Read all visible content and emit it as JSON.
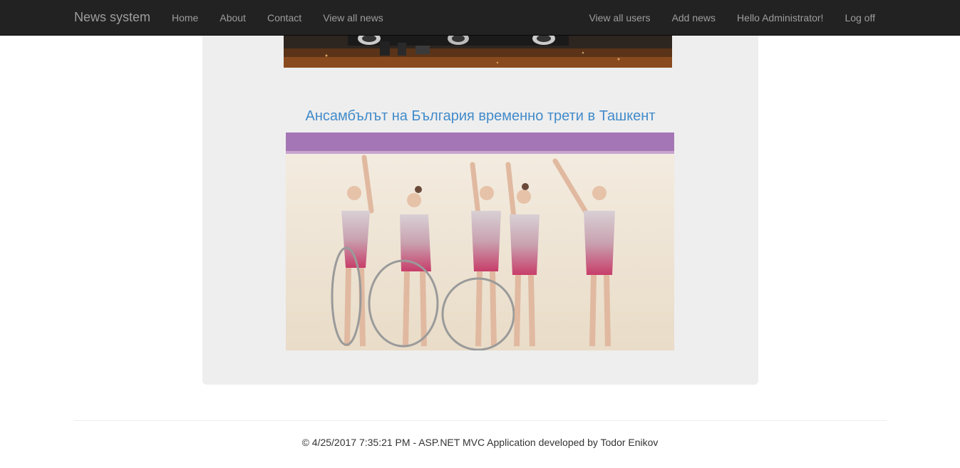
{
  "navbar": {
    "brand": "News system",
    "left_links": [
      "Home",
      "About",
      "Contact",
      "View all news"
    ],
    "right_links": [
      "View all users",
      "Add news",
      "Hello Administrator!",
      "Log off"
    ]
  },
  "news": [
    {
      "image_alt": "car-photo"
    },
    {
      "title": "Ансамбълът на България временно трети в Ташкент",
      "image_alt": "gymnastics-team-photo"
    }
  ],
  "footer": {
    "text": "© 4/25/2017 7:35:21 PM - ASP.NET MVC Application developed by Todor Enikov"
  },
  "colors": {
    "navbar_bg": "#222222",
    "nav_text": "#9d9d9d",
    "link": "#428bca",
    "jumbotron_bg": "#eeeeee"
  }
}
